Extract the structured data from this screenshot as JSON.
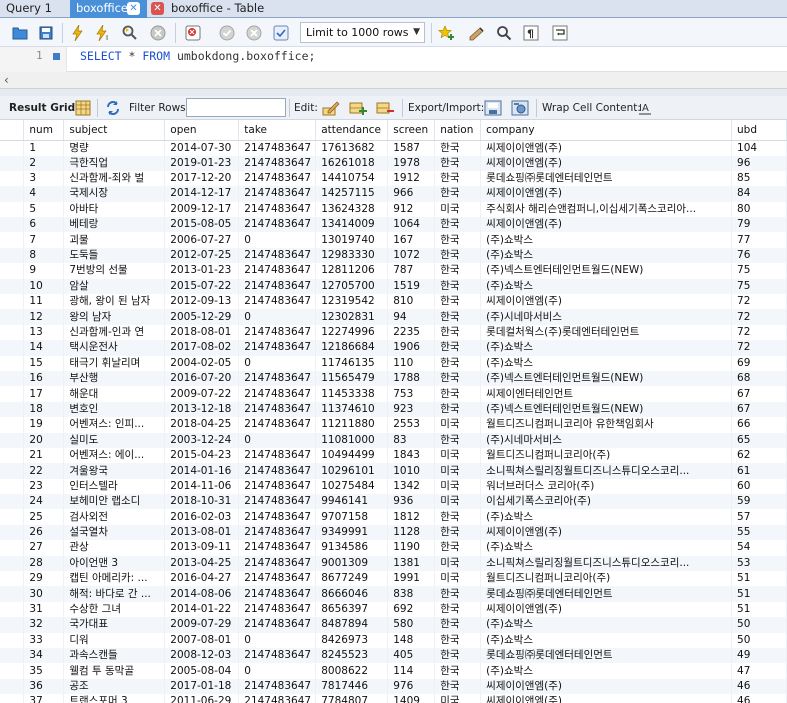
{
  "tabs": [
    {
      "label": "Query 1",
      "active": false,
      "closable": false
    },
    {
      "label": "boxoffice",
      "active": true,
      "closable": true
    },
    {
      "label": "boxoffice - Table",
      "active": false,
      "closable": true
    }
  ],
  "toolbar": {
    "limit_value": "Limit to 1000 rows"
  },
  "editor": {
    "line_number": "1",
    "query_kw1": "SELECT",
    "query_star": " * ",
    "query_kw2": "FROM",
    "query_table": " umbokdong.boxoffice;"
  },
  "result_toolbar": {
    "result_grid_label": "Result Grid",
    "filter_rows_label": "Filter Rows:",
    "filter_value": "",
    "edit_label": "Edit:",
    "export_import_label": "Export/Import:",
    "wrap_label": "Wrap Cell Content:"
  },
  "columns": [
    "num",
    "subject",
    "open",
    "take",
    "attendance",
    "screen",
    "nation",
    "company",
    "ubd"
  ],
  "rows": [
    [
      "1",
      "명량",
      "2014-07-30",
      "2147483647",
      "17613682",
      "1587",
      "한국",
      "씨제이이앤엠(주)",
      "104"
    ],
    [
      "2",
      "극한직업",
      "2019-01-23",
      "2147483647",
      "16261018",
      "1978",
      "한국",
      "씨제이이앤엠(주)",
      "96"
    ],
    [
      "3",
      "신과함께-죄와 벌",
      "2017-12-20",
      "2147483647",
      "14410754",
      "1912",
      "한국",
      "롯데쇼핑㈜롯데엔터테인먼트",
      "85"
    ],
    [
      "4",
      "국제시장",
      "2014-12-17",
      "2147483647",
      "14257115",
      "966",
      "한국",
      "씨제이이앤엠(주)",
      "84"
    ],
    [
      "5",
      "아바타",
      "2009-12-17",
      "2147483647",
      "13624328",
      "912",
      "미국",
      "주식회사 해리슨앤컴퍼니,이십세기폭스코리아...",
      "80"
    ],
    [
      "6",
      "베테랑",
      "2015-08-05",
      "2147483647",
      "13414009",
      "1064",
      "한국",
      "씨제이이앤엠(주)",
      "79"
    ],
    [
      "7",
      "괴물",
      "2006-07-27",
      "0",
      "13019740",
      "167",
      "한국",
      "(주)쇼박스",
      "77"
    ],
    [
      "8",
      "도둑들",
      "2012-07-25",
      "2147483647",
      "12983330",
      "1072",
      "한국",
      "(주)쇼박스",
      "76"
    ],
    [
      "9",
      "7번방의 선물",
      "2013-01-23",
      "2147483647",
      "12811206",
      "787",
      "한국",
      "(주)넥스트엔터테인먼트월드(NEW)",
      "75"
    ],
    [
      "10",
      "암살",
      "2015-07-22",
      "2147483647",
      "12705700",
      "1519",
      "한국",
      "(주)쇼박스",
      "75"
    ],
    [
      "11",
      "광해, 왕이 된 남자",
      "2012-09-13",
      "2147483647",
      "12319542",
      "810",
      "한국",
      "씨제이이앤엠(주)",
      "72"
    ],
    [
      "12",
      "왕의 남자",
      "2005-12-29",
      "0",
      "12302831",
      "94",
      "한국",
      "(주)시네마서비스",
      "72"
    ],
    [
      "13",
      "신과함께-인과 연",
      "2018-08-01",
      "2147483647",
      "12274996",
      "2235",
      "한국",
      "롯데컬처웍스(주)롯데엔터테인먼트",
      "72"
    ],
    [
      "14",
      "택시운전사",
      "2017-08-02",
      "2147483647",
      "12186684",
      "1906",
      "한국",
      "(주)쇼박스",
      "72"
    ],
    [
      "15",
      "태극기 휘날리며",
      "2004-02-05",
      "0",
      "11746135",
      "110",
      "한국",
      "(주)쇼박스",
      "69"
    ],
    [
      "16",
      "부산행",
      "2016-07-20",
      "2147483647",
      "11565479",
      "1788",
      "한국",
      "(주)넥스트엔터테인먼트월드(NEW)",
      "68"
    ],
    [
      "17",
      "해운대",
      "2009-07-22",
      "2147483647",
      "11453338",
      "753",
      "한국",
      "씨제이엔터테인먼트",
      "67"
    ],
    [
      "18",
      "변호인",
      "2013-12-18",
      "2147483647",
      "11374610",
      "923",
      "한국",
      "(주)넥스트엔터테인먼트월드(NEW)",
      "67"
    ],
    [
      "19",
      "어벤져스: 인피...",
      "2018-04-25",
      "2147483647",
      "11211880",
      "2553",
      "미국",
      "월트디즈니컴퍼니코리아 유한책임회사",
      "66"
    ],
    [
      "20",
      "실미도",
      "2003-12-24",
      "0",
      "11081000",
      "83",
      "한국",
      "(주)시네마서비스",
      "65"
    ],
    [
      "21",
      "어벤져스: 에이...",
      "2015-04-23",
      "2147483647",
      "10494499",
      "1843",
      "미국",
      "월트디즈니컴퍼니코리아(주)",
      "62"
    ],
    [
      "22",
      "겨울왕국",
      "2014-01-16",
      "2147483647",
      "10296101",
      "1010",
      "미국",
      "소니픽쳐스릴리징월트디즈니스튜디오스코리...",
      "61"
    ],
    [
      "23",
      "인터스텔라",
      "2014-11-06",
      "2147483647",
      "10275484",
      "1342",
      "미국",
      "워너브러더스 코리아(주)",
      "60"
    ],
    [
      "24",
      "보헤미안 랩소디",
      "2018-10-31",
      "2147483647",
      "9946141",
      "936",
      "미국",
      "이십세기폭스코리아(주)",
      "59"
    ],
    [
      "25",
      "검사외전",
      "2016-02-03",
      "2147483647",
      "9707158",
      "1812",
      "한국",
      "(주)쇼박스",
      "57"
    ],
    [
      "26",
      "설국열차",
      "2013-08-01",
      "2147483647",
      "9349991",
      "1128",
      "한국",
      "씨제이이앤엠(주)",
      "55"
    ],
    [
      "27",
      "관상",
      "2013-09-11",
      "2147483647",
      "9134586",
      "1190",
      "한국",
      "(주)쇼박스",
      "54"
    ],
    [
      "28",
      "아이언맨 3",
      "2013-04-25",
      "2147483647",
      "9001309",
      "1381",
      "미국",
      "소니픽쳐스릴리징월트디즈니스튜디오스코리...",
      "53"
    ],
    [
      "29",
      "캡틴 아메리카: ...",
      "2016-04-27",
      "2147483647",
      "8677249",
      "1991",
      "미국",
      "월트디즈니컴퍼니코리아(주)",
      "51"
    ],
    [
      "30",
      "해적: 바다로 간 ...",
      "2014-08-06",
      "2147483647",
      "8666046",
      "838",
      "한국",
      "롯데쇼핑㈜롯데엔터테인먼트",
      "51"
    ],
    [
      "31",
      "수상한 그녀",
      "2014-01-22",
      "2147483647",
      "8656397",
      "692",
      "한국",
      "씨제이이앤엠(주)",
      "51"
    ],
    [
      "32",
      "국가대표",
      "2009-07-29",
      "2147483647",
      "8487894",
      "580",
      "한국",
      "(주)쇼박스",
      "50"
    ],
    [
      "33",
      "디워",
      "2007-08-01",
      "0",
      "8426973",
      "148",
      "한국",
      "(주)쇼박스",
      "50"
    ],
    [
      "34",
      "과속스캔들",
      "2008-12-03",
      "2147483647",
      "8245523",
      "405",
      "한국",
      "롯데쇼핑㈜롯데엔터테인먼트",
      "49"
    ],
    [
      "35",
      "웰컴 투 동막골",
      "2005-08-04",
      "0",
      "8008622",
      "114",
      "한국",
      "(주)쇼박스",
      "47"
    ],
    [
      "36",
      "공조",
      "2017-01-18",
      "2147483647",
      "7817446",
      "976",
      "한국",
      "씨제이이앤엠(주)",
      "46"
    ],
    [
      "37",
      "트랜스포머 3",
      "2011-06-29",
      "2147483647",
      "7784807",
      "1409",
      "미국",
      "씨제이이앤엠(주)",
      "46"
    ]
  ]
}
